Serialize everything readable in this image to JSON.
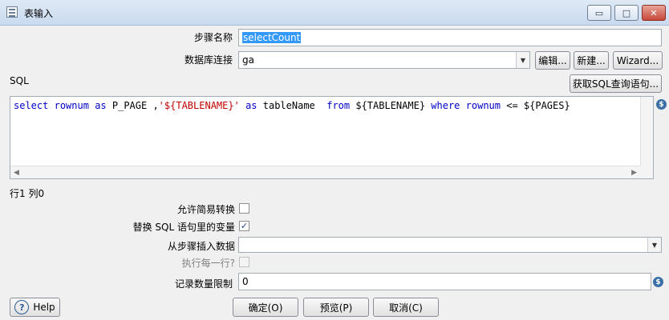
{
  "window": {
    "title": "表输入",
    "minimize_label": "▭",
    "maximize_label": "□",
    "close_label": "✕"
  },
  "form": {
    "step_name_label": "步骤名称",
    "step_name_value": "selectCount",
    "db_connection_label": "数据库连接",
    "db_connection_value": "ga",
    "edit_button": "编辑...",
    "new_button": "新建...",
    "wizard_button": "Wizard...",
    "sql_label": "SQL",
    "get_sql_button": "获取SQL查询语句...",
    "sql_tokens": [
      {
        "t": "select",
        "c": "kw"
      },
      {
        "t": " ",
        "c": "plain"
      },
      {
        "t": "rownum",
        "c": "kw"
      },
      {
        "t": " ",
        "c": "plain"
      },
      {
        "t": "as",
        "c": "kw"
      },
      {
        "t": " P_PAGE ,",
        "c": "plain"
      },
      {
        "t": "'${TABLENAME}'",
        "c": "str"
      },
      {
        "t": " ",
        "c": "plain"
      },
      {
        "t": "as",
        "c": "kw"
      },
      {
        "t": " tableName  ",
        "c": "plain"
      },
      {
        "t": "from",
        "c": "kw"
      },
      {
        "t": " ${TABLENAME} ",
        "c": "plain"
      },
      {
        "t": "where",
        "c": "kw"
      },
      {
        "t": " ",
        "c": "plain"
      },
      {
        "t": "rownum",
        "c": "kw"
      },
      {
        "t": " <= ${PAGES}",
        "c": "plain"
      }
    ],
    "cursor_position": "行1 列0",
    "lazy_conversion_label": "允许简易转换",
    "lazy_conversion_checked": false,
    "replace_vars_label": "替换 SQL 语句里的变量",
    "replace_vars_checked": true,
    "insert_from_step_label": "从步骤插入数据",
    "insert_from_step_value": "",
    "execute_each_row_label": "执行每一行?",
    "execute_each_row_checked": false,
    "limit_label": "记录数量限制",
    "limit_value": "0"
  },
  "footer": {
    "help_button": "Help",
    "ok_button": "确定(O)",
    "preview_button": "预览(P)",
    "cancel_button": "取消(C)"
  },
  "icons": {
    "variable_icon": "$",
    "dropdown_icon": "▼",
    "check_mark": "✓"
  },
  "colors": {
    "sql_keyword": "#0000c8",
    "sql_string": "#c00000",
    "selection": "#3399ff"
  }
}
